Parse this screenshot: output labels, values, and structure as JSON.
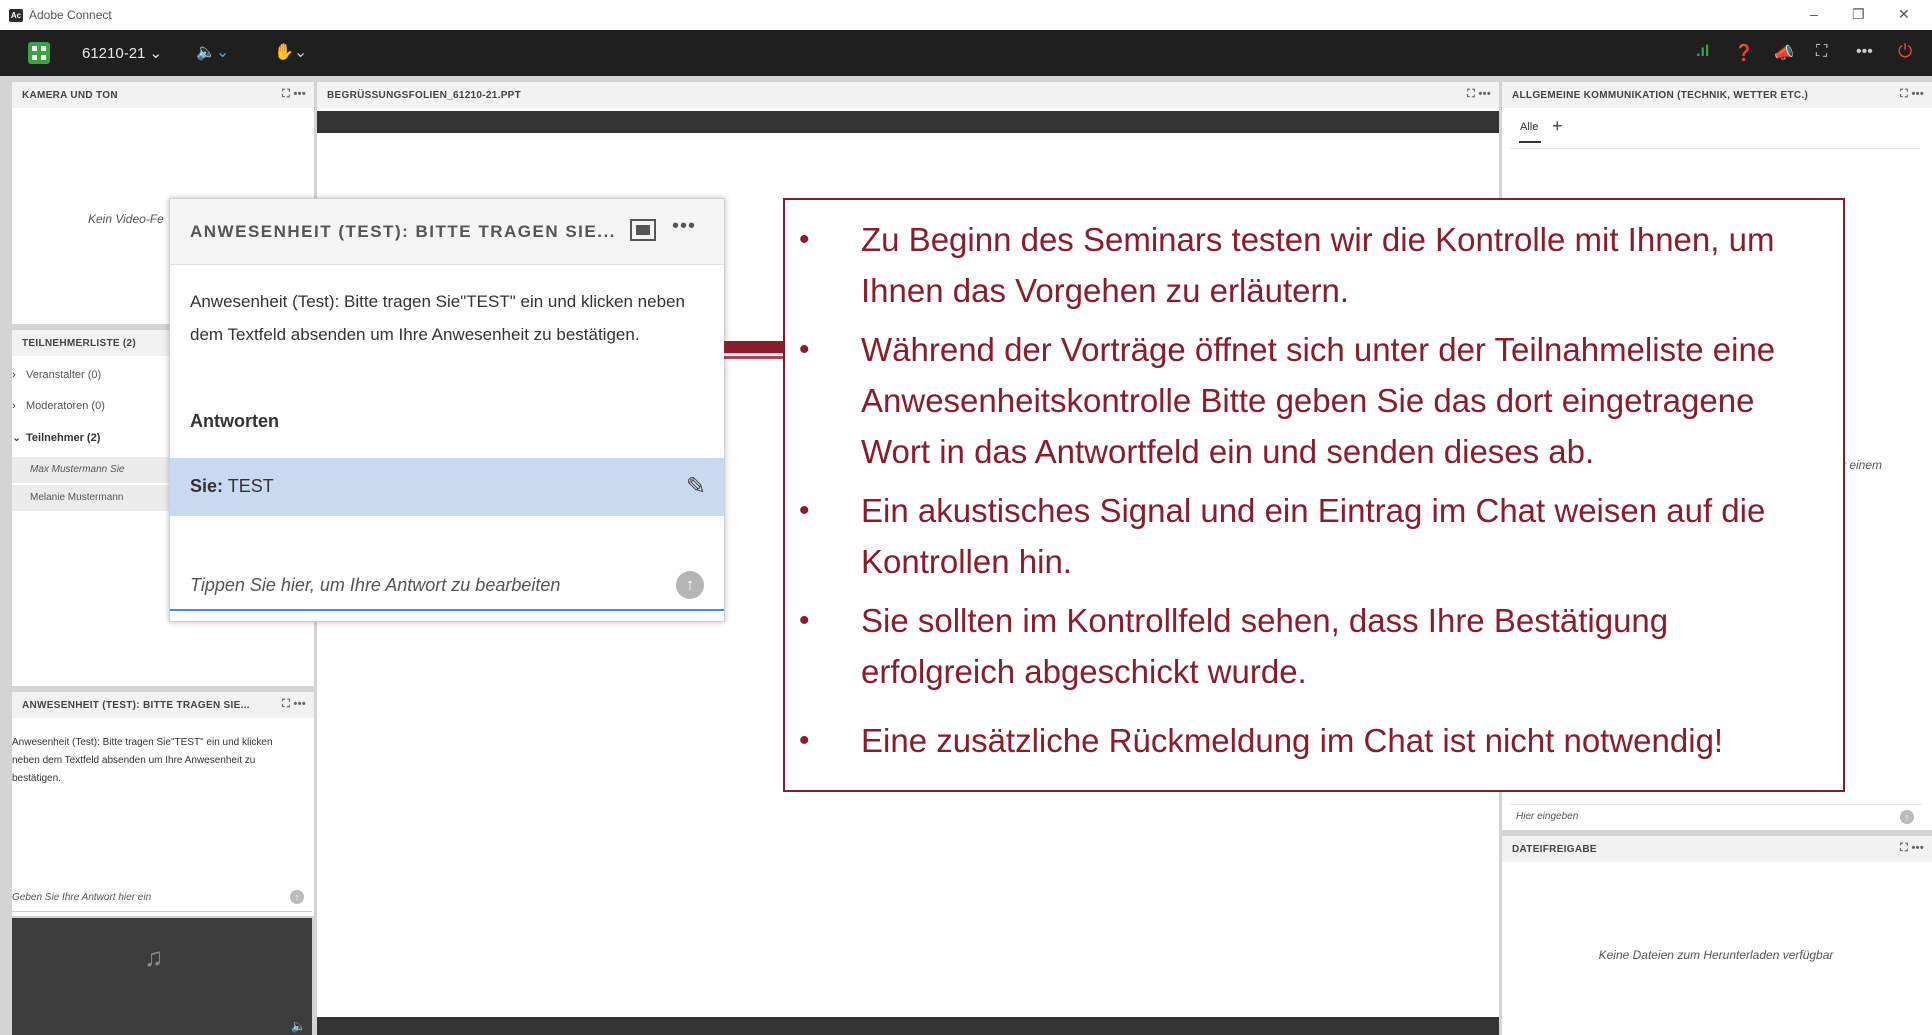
{
  "window": {
    "title": "Adobe Connect",
    "app_icon_letters": "Ac",
    "minimize_glyph": "–",
    "restore_glyph": "❐",
    "close_glyph": "✕"
  },
  "toolbar": {
    "room": "61210-21 ⌄",
    "speaker_glyph": "🔈⌄",
    "hand_glyph": "✋⌄",
    "signal_glyph": ".ıl",
    "help_glyph": "❓",
    "notif_glyph": "📣",
    "fullscreen_glyph": "⛶",
    "more_glyph": "•••",
    "power_glyph": "⏻",
    "accent_color": "#3da243",
    "power_color": "#e74c3c"
  },
  "camera_pod": {
    "title": "KAMERA UND TON",
    "empty_text": "Kein Video-Fe"
  },
  "attendees_pod": {
    "title": "TEILNEHMERLISTE  (2)",
    "groups": [
      {
        "chevron": "›",
        "label": "Veranstalter (0)"
      },
      {
        "chevron": "›",
        "label": "Moderatoren (0)"
      },
      {
        "chevron": "⌄",
        "label": "Teilnehmer (2)"
      }
    ],
    "members": [
      "Max Mustermann Sie",
      "Melanie Mustermann"
    ]
  },
  "attendance_pod_small": {
    "title": "ANWESENHEIT (TEST): BITTE TRAGEN SIE...",
    "question": "Anwesenheit (Test): Bitte tragen Sie\"TEST\" ein und klicken neben dem Textfeld absenden um Ihre Anwesenheit zu bestätigen.",
    "input_placeholder": "Geben Sie Ihre Antwort hier ein",
    "music_glyph": "♫",
    "volume_glyph": "🔈"
  },
  "share_pod": {
    "title": "BEGRÜSSUNGSFOLIEN_61210-21.PPT"
  },
  "chat_pod": {
    "title": "ALLGEMEINE KOMMUNIKATION (TECHNIK, WETTER ETC.)",
    "tab": "Alle",
    "add_glyph": "+",
    "fragment": "r einem",
    "input_placeholder": "Hier eingeben"
  },
  "files_pod": {
    "title": "DATEIFREIGABE",
    "empty_text": "Keine Dateien zum Herunterladen verfügbar"
  },
  "pod_controls": {
    "maximize_glyph": "⛶",
    "more_glyph": "•••"
  },
  "zoom_popup": {
    "title": "ANWESENHEIT (TEST): BITTE TRAGEN SIE...",
    "question": "Anwesenheit (Test): Bitte tragen Sie\"TEST\" ein und klicken neben dem Textfeld absenden um Ihre Anwesenheit zu bestätigen.",
    "answers_label": "Antworten",
    "answer_who": "Sie:",
    "answer_text": "TEST",
    "edit_glyph": "✎",
    "input_placeholder": "Tippen Sie hier, um Ihre Antwort zu bearbeiten",
    "send_glyph": "↑",
    "more_glyph": "•••"
  },
  "callout": {
    "color": "#8b1c2c",
    "bullets": [
      "Zu Beginn des Seminars testen wir die Kontrolle mit Ihnen, um Ihnen das Vorgehen zu erläutern.",
      "Während der Vorträge öffnet sich unter der Teilnahmeliste eine Anwesenheitskontrolle Bitte geben Sie das dort eingetragene Wort in das Antwortfeld ein und senden dieses ab.",
      "Ein akustisches Signal und ein Eintrag im Chat weisen auf die Kontrollen hin.",
      "Sie sollten im Kontrollfeld sehen, dass Ihre Bestätigung erfolgreich abgeschickt wurde.",
      "Eine zusätzliche Rückmeldung im Chat ist nicht notwendig!"
    ]
  }
}
